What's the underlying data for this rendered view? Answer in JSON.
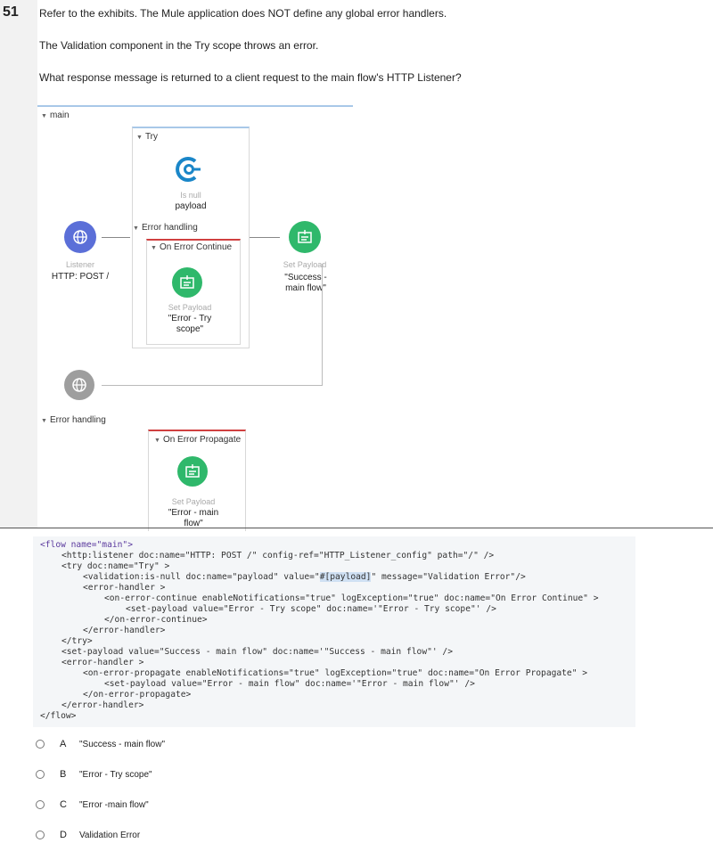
{
  "question": {
    "number": "51",
    "line1": "Refer to the exhibits. The Mule application does NOT define any global error handlers.",
    "line2": "The Validation component in the Try scope throws an error.",
    "line3": "What response message is returned to a client request to the main flow's HTTP Listener?"
  },
  "diagram": {
    "main_label": "main",
    "try_label": "Try",
    "validation": {
      "type": "Is null",
      "name": "payload"
    },
    "try_error_handling": "Error handling",
    "on_error_continue": "On Error Continue",
    "try_set_payload": {
      "type": "Set Payload",
      "name": "\"Error - Try scope\""
    },
    "listener": {
      "type": "Listener",
      "name": "HTTP: POST /"
    },
    "main_set_payload": {
      "type": "Set Payload",
      "name": "\"Success - main flow\""
    },
    "main_error_handling": "Error handling",
    "on_error_propagate": "On Error Propagate",
    "prop_set_payload": {
      "type": "Set Payload",
      "name": "\"Error - main flow\""
    },
    "colors": {
      "listener": "#5b6fd8",
      "component": "#2fb86b",
      "validation": "#1a86c8",
      "response": "#9e9e9e",
      "scope_top": "#a8c8e8",
      "handler_top": "#d04040"
    }
  },
  "code": {
    "l1": "<flow name=\"main\">",
    "l2": "<http:listener doc:name=\"HTTP: POST /\" config-ref=\"HTTP_Listener_config\" path=\"/\" />",
    "l3": "<try doc:name=\"Try\" >",
    "l4a": "<validation:is-null doc:name=\"payload\" value=\"",
    "l4b": "#[payload]",
    "l4c": "\" message=\"Validation Error\"/>",
    "l5": "<error-handler >",
    "l6": "<on-error-continue enableNotifications=\"true\" logException=\"true\" doc:name=\"On Error Continue\" >",
    "l7": "<set-payload value=\"Error - Try scope\" doc:name='\"Error - Try scope\"' />",
    "l8": "</on-error-continue>",
    "l9": "</error-handler>",
    "l10": "</try>",
    "l11": "<set-payload value=\"Success - main flow\" doc:name='\"Success - main flow\"' />",
    "l12": "<error-handler >",
    "l13": "<on-error-propagate enableNotifications=\"true\" logException=\"true\" doc:name=\"On Error Propagate\" >",
    "l14": "<set-payload value=\"Error - main flow\" doc:name='\"Error - main flow\"' />",
    "l15": "</on-error-propagate>",
    "l16": "</error-handler>",
    "l17": "</flow>"
  },
  "options": [
    {
      "letter": "A",
      "text": "\"Success - main flow\""
    },
    {
      "letter": "B",
      "text": "\"Error - Try scope\""
    },
    {
      "letter": "C",
      "text": "\"Error -main flow\""
    },
    {
      "letter": "D",
      "text": "Validation Error"
    }
  ]
}
